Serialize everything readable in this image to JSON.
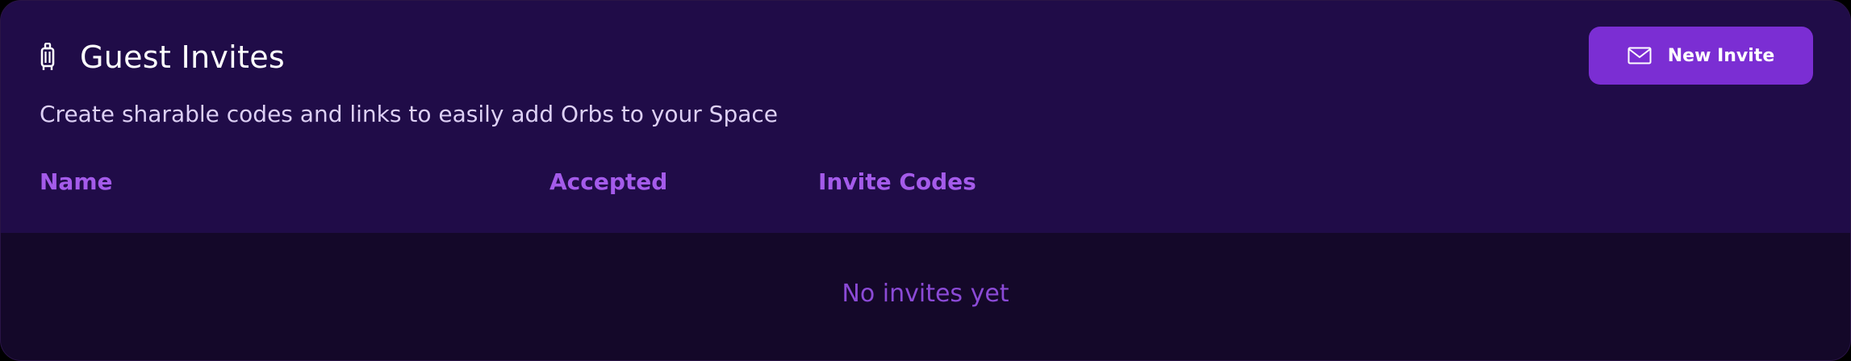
{
  "panel": {
    "title": "Guest Invites",
    "title_icon": "luggage-icon",
    "subtitle": "Create sharable codes and links to easily add Orbs to your Space",
    "new_invite_button": {
      "label": "New Invite",
      "icon": "envelope-icon"
    }
  },
  "table": {
    "columns": [
      "Name",
      "Accepted",
      "Invite Codes"
    ],
    "rows": [],
    "empty_message": "No invites yet"
  },
  "colors": {
    "header_bg": "#200c48",
    "body_bg": "#140829",
    "accent": "#7b2ed3",
    "column_header": "#a45bea",
    "empty_text": "#8b4ad6"
  }
}
